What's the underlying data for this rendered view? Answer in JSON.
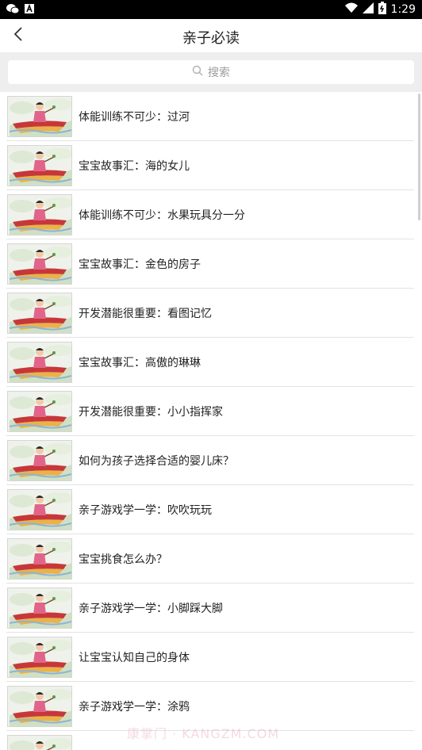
{
  "status_bar": {
    "time": "1:29"
  },
  "header": {
    "title": "亲子必读"
  },
  "search": {
    "placeholder": "搜索"
  },
  "items": [
    {
      "title": "体能训练不可少：过河"
    },
    {
      "title": "宝宝故事汇：海的女儿"
    },
    {
      "title": "体能训练不可少：水果玩具分一分"
    },
    {
      "title": "宝宝故事汇：金色的房子"
    },
    {
      "title": "开发潜能很重要：看图记忆"
    },
    {
      "title": "宝宝故事汇：高傲的琳琳"
    },
    {
      "title": "开发潜能很重要：小小指挥家"
    },
    {
      "title": "如何为孩子选择合适的婴儿床？"
    },
    {
      "title": "亲子游戏学一学：吹吹玩玩"
    },
    {
      "title": "宝宝挑食怎么办？"
    },
    {
      "title": "亲子游戏学一学：小脚踩大脚"
    },
    {
      "title": "让宝宝认知自己的身体"
    },
    {
      "title": "亲子游戏学一学：涂鸦"
    },
    {
      "title": ""
    }
  ],
  "watermark": "康掌门 · KANGZM.COM",
  "colors": {
    "status_bar_bg": "#000000",
    "search_area_bg": "#eeeeee",
    "divider": "#e3e3e3",
    "thumbnail_bg": "#e9eee6"
  },
  "icons": {
    "back": "chevron-left-icon",
    "search": "search-icon",
    "wifi": "wifi-icon",
    "signal": "signal-icon",
    "battery": "battery-icon",
    "wechat": "wechat-icon",
    "notification": "notification-icon"
  }
}
